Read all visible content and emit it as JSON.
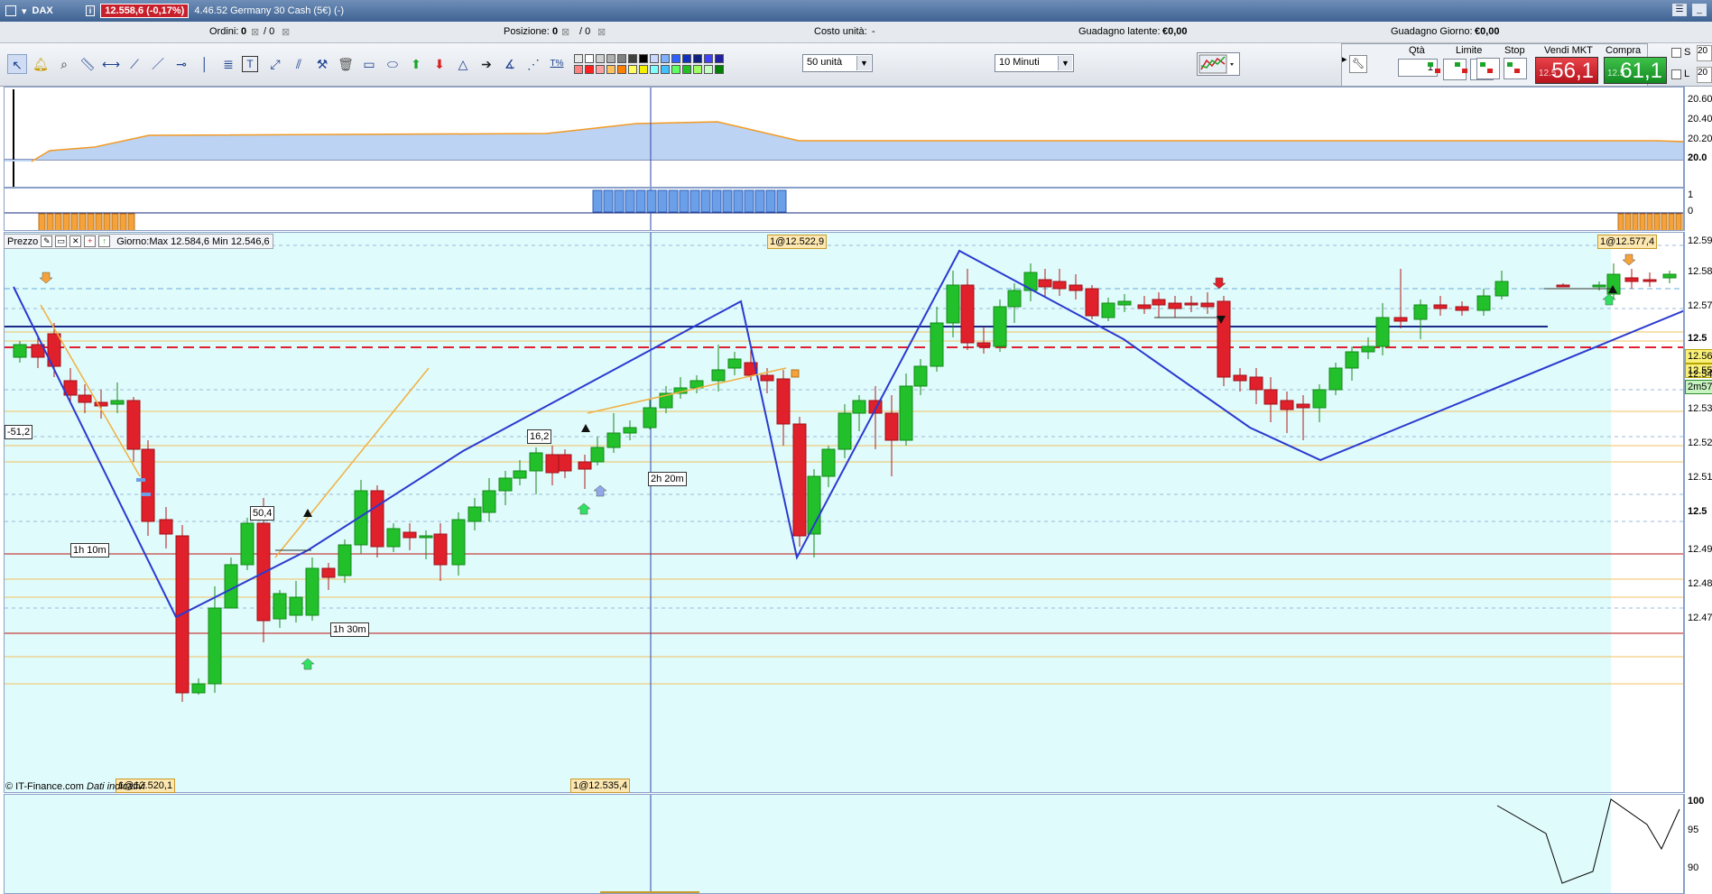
{
  "window": {
    "symbol": "DAX",
    "price_badge": "12.558,6 (-0,17%)",
    "description": "4.46.52 Germany 30 Cash (5€) (-)"
  },
  "infobar": {
    "ordini_label": "Ordini:",
    "ordini_value": "0",
    "ordini_sep": "/ 0",
    "posizione_label": "Posizione:",
    "posizione_value": "0",
    "posizione_sep": "/ 0",
    "costo_label": "Costo unità:",
    "costo_value": "-",
    "latente_label": "Guadagno latente:",
    "latente_value": "€0,00",
    "giorno_label": "Guadagno Giorno:",
    "giorno_value": "€0,00"
  },
  "toolbar": {
    "units_select": "50 unità",
    "timeframe_select": "10 Minuti",
    "palette_colors": [
      "#e8e8e8",
      "#ffffff",
      "#d0d0d0",
      "#b0b0b0",
      "#808080",
      "#404040",
      "#000000",
      "#c9d8ff",
      "#7fb0ff",
      "#3060ff",
      "#1030c0",
      "#102080",
      "#4040ff",
      "#2020a0",
      "#ff8080",
      "#ff2020",
      "#ffa0a0",
      "#ffc060",
      "#ff8000",
      "#ffff60",
      "#f0f000",
      "#80ffff",
      "#40c0ff",
      "#60ff60",
      "#20c020",
      "#a0ff60",
      "#c0ffc0",
      "#008000"
    ]
  },
  "order_panel": {
    "qty_label": "Qtà",
    "qty_value": "1",
    "limit_label": "Limite",
    "stop_label": "Stop",
    "sell_label": "Vendi MKT",
    "buy_label": "Compra MKT",
    "sell_small": "12.5",
    "sell_big": "56,1",
    "buy_small": "12.5",
    "buy_big": "61,1",
    "s_label": "S",
    "l_label": "L",
    "s_value": "20",
    "l_value": "20"
  },
  "top_axis": [
    "20.60",
    "20.40",
    "20.20",
    "20.0"
  ],
  "strip_axis": [
    "1",
    "0"
  ],
  "price_panel": {
    "title": "Prezzo",
    "day_info": "Giorno:Max 12.584,6 Min 12.546,6",
    "axis_labels": [
      "12.59",
      "12.58",
      "12.57",
      "12.5",
      "12.54",
      "12.53",
      "12.52",
      "12.51",
      "12.5",
      "12.49",
      "12.48",
      "12.47"
    ],
    "axis_tags": [
      "12.56",
      "12.55",
      "2m57"
    ],
    "tags": {
      "t1": "1@12.522,9",
      "t2": "1@12.577,4",
      "t3": "-51,2",
      "t4": "16,2",
      "t5": "50,4",
      "t6": "1h 10m",
      "t7": "1h 30m",
      "t8": "2h 20m",
      "t9": "1@12.520,1",
      "t10": "1@12.535,4"
    },
    "footer_brand": "© IT-Finance.com",
    "footer_note": "Dati indicativi"
  },
  "bottom_axis": [
    "100",
    "95",
    "90"
  ]
}
